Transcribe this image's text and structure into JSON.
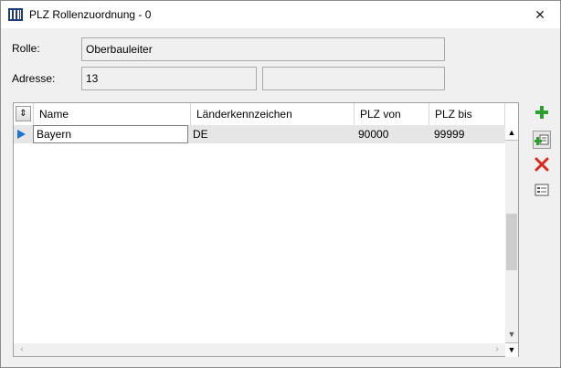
{
  "window": {
    "title": "PLZ Rollenzuordnung - 0",
    "close_symbol": "✕"
  },
  "form": {
    "rolle_label": "Rolle:",
    "rolle_value": "Oberbauleiter",
    "adresse_label": "Adresse:",
    "adresse_value": "13",
    "adresse_extra_value": ""
  },
  "grid": {
    "columns": [
      "Name",
      "Länderkennzeichen",
      "PLZ von",
      "PLZ bis"
    ],
    "rows": [
      {
        "name": "Bayern",
        "laenderkennzeichen": "DE",
        "plz_von": "90000",
        "plz_bis": "99999"
      }
    ]
  },
  "toolbar": {
    "icons": [
      "add-icon",
      "add-row-icon",
      "delete-icon",
      "details-icon"
    ],
    "accent_green": "#2e9e2e",
    "accent_red": "#d9281c"
  }
}
